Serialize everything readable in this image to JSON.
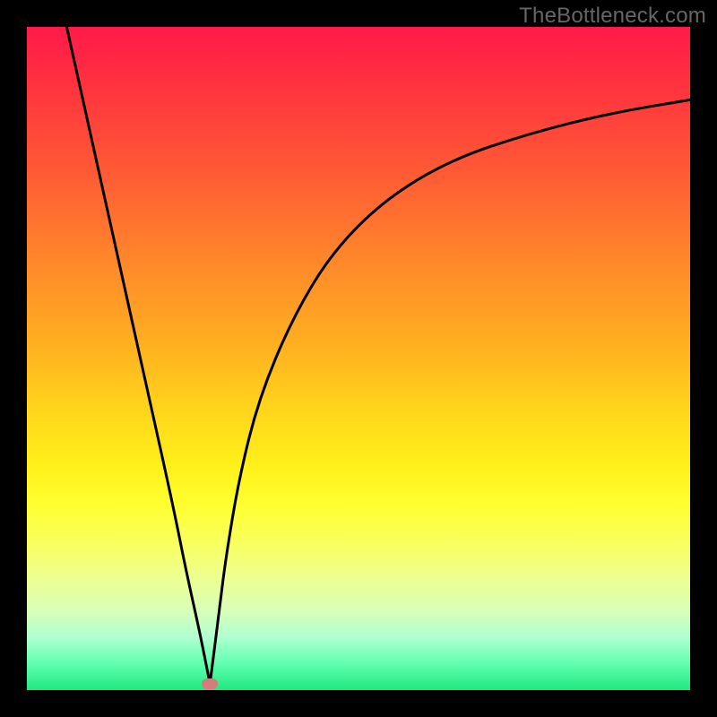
{
  "watermark": "TheBottleneck.com",
  "chart_data": {
    "type": "line",
    "title": "",
    "xlabel": "",
    "ylabel": "",
    "xlim": [
      0,
      100
    ],
    "ylim": [
      0,
      100
    ],
    "series": [
      {
        "name": "left-branch",
        "x": [
          6,
          10,
          14,
          18,
          22,
          24,
          26,
          27,
          27.6
        ],
        "values": [
          100,
          82,
          64,
          46,
          28,
          18,
          9,
          4,
          1
        ]
      },
      {
        "name": "right-branch",
        "x": [
          27.6,
          28,
          29,
          30,
          32,
          35,
          40,
          46,
          54,
          64,
          76,
          88,
          100
        ],
        "values": [
          1,
          4,
          12,
          20,
          32,
          44,
          56,
          66,
          74,
          80,
          84,
          87,
          89
        ]
      }
    ],
    "marker": {
      "x": 27.6,
      "y": 1,
      "color": "#d77b7b"
    },
    "gradient_stops": [
      {
        "pos": 0,
        "color": "#ff1a49"
      },
      {
        "pos": 50,
        "color": "#ffd61c"
      },
      {
        "pos": 80,
        "color": "#ffff30"
      },
      {
        "pos": 100,
        "color": "#20e880"
      }
    ]
  }
}
